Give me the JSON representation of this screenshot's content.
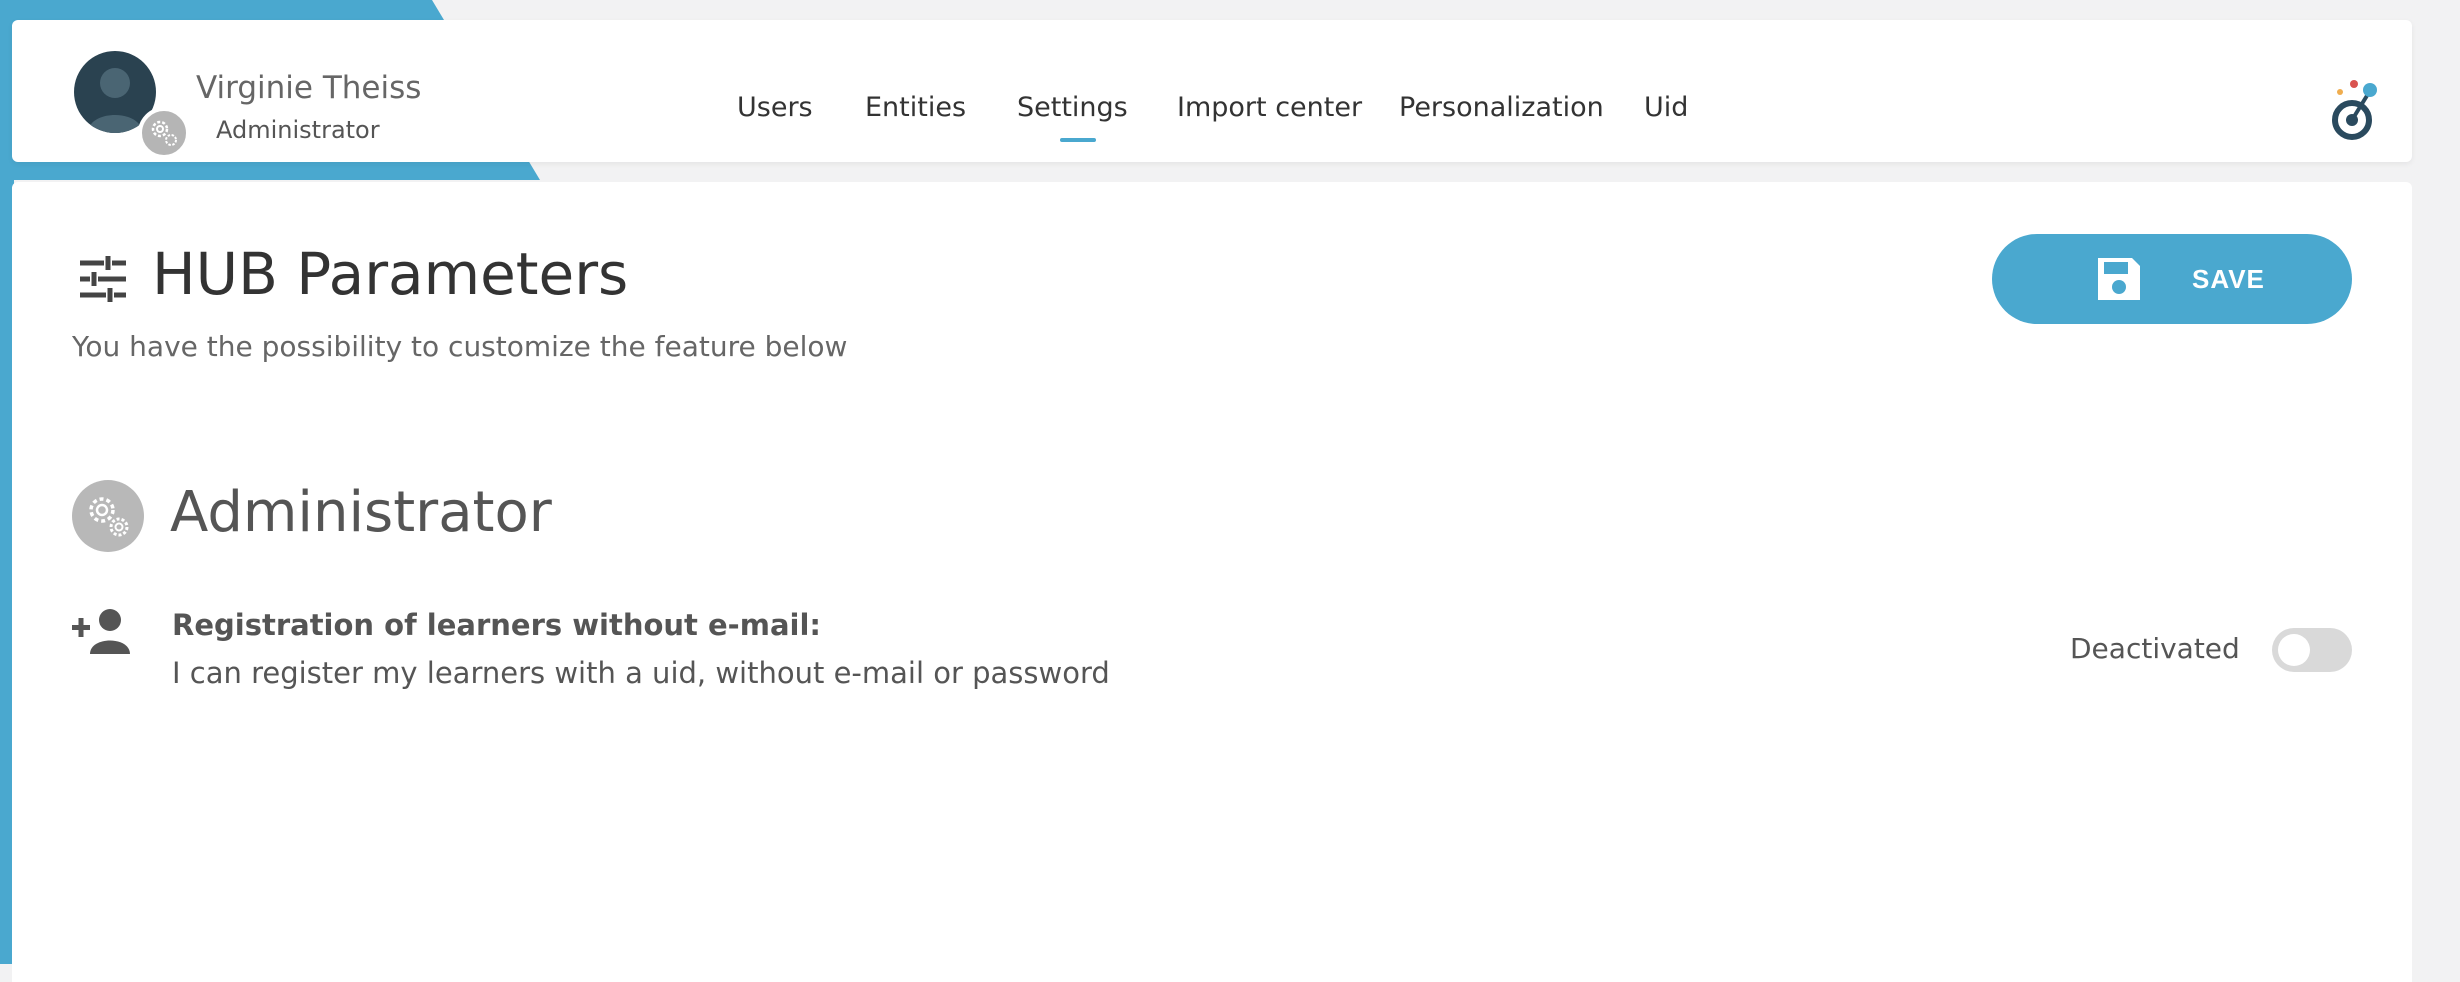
{
  "user": {
    "name": "Virginie Theiss",
    "role": "Administrator"
  },
  "nav": {
    "items": [
      {
        "label": "Users"
      },
      {
        "label": "Entities"
      },
      {
        "label": "Settings",
        "active": true
      },
      {
        "label": "Import center"
      },
      {
        "label": "Personalization"
      },
      {
        "label": "Uid"
      }
    ]
  },
  "page": {
    "title": "HUB Parameters",
    "subtitle": "You have the possibility to customize the feature below",
    "save_label": "SAVE"
  },
  "section": {
    "title": "Administrator",
    "option": {
      "label": "Registration of learners without e-mail:",
      "description": "I can register my learners with a uid, without e-mail or password",
      "status": "Deactivated",
      "enabled": false
    }
  },
  "colors": {
    "accent": "#4aa8cf",
    "toggle_off": "#d9d9d9",
    "icon_gray": "#b8b8b8"
  },
  "icons": {
    "sliders": "sliders-icon",
    "save": "floppy-disk-icon",
    "gears": "gears-icon",
    "add_user": "add-user-icon",
    "logo": "target-logo-icon"
  }
}
